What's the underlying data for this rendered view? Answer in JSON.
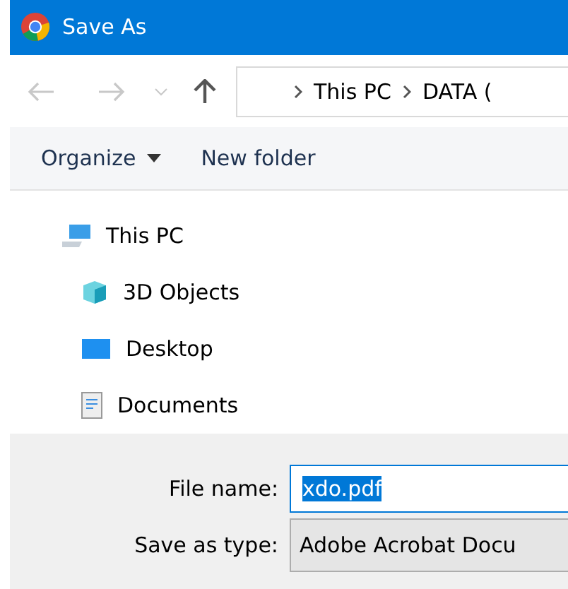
{
  "window": {
    "title": "Save As"
  },
  "address_bar": {
    "crumbs": [
      "This PC",
      "DATA ("
    ]
  },
  "toolbar": {
    "organize": "Organize",
    "new_folder": "New folder"
  },
  "tree": [
    {
      "label": "This PC",
      "kind": "pc",
      "children": [
        {
          "label": "3D Objects",
          "kind": "cube"
        },
        {
          "label": "Desktop",
          "kind": "desktop"
        },
        {
          "label": "Documents",
          "kind": "docs"
        }
      ]
    }
  ],
  "form": {
    "file_name_label": "File name:",
    "file_name": "xdo.pdf",
    "type_label": "Save as type:",
    "type_value": "Adobe Acrobat Docu"
  }
}
